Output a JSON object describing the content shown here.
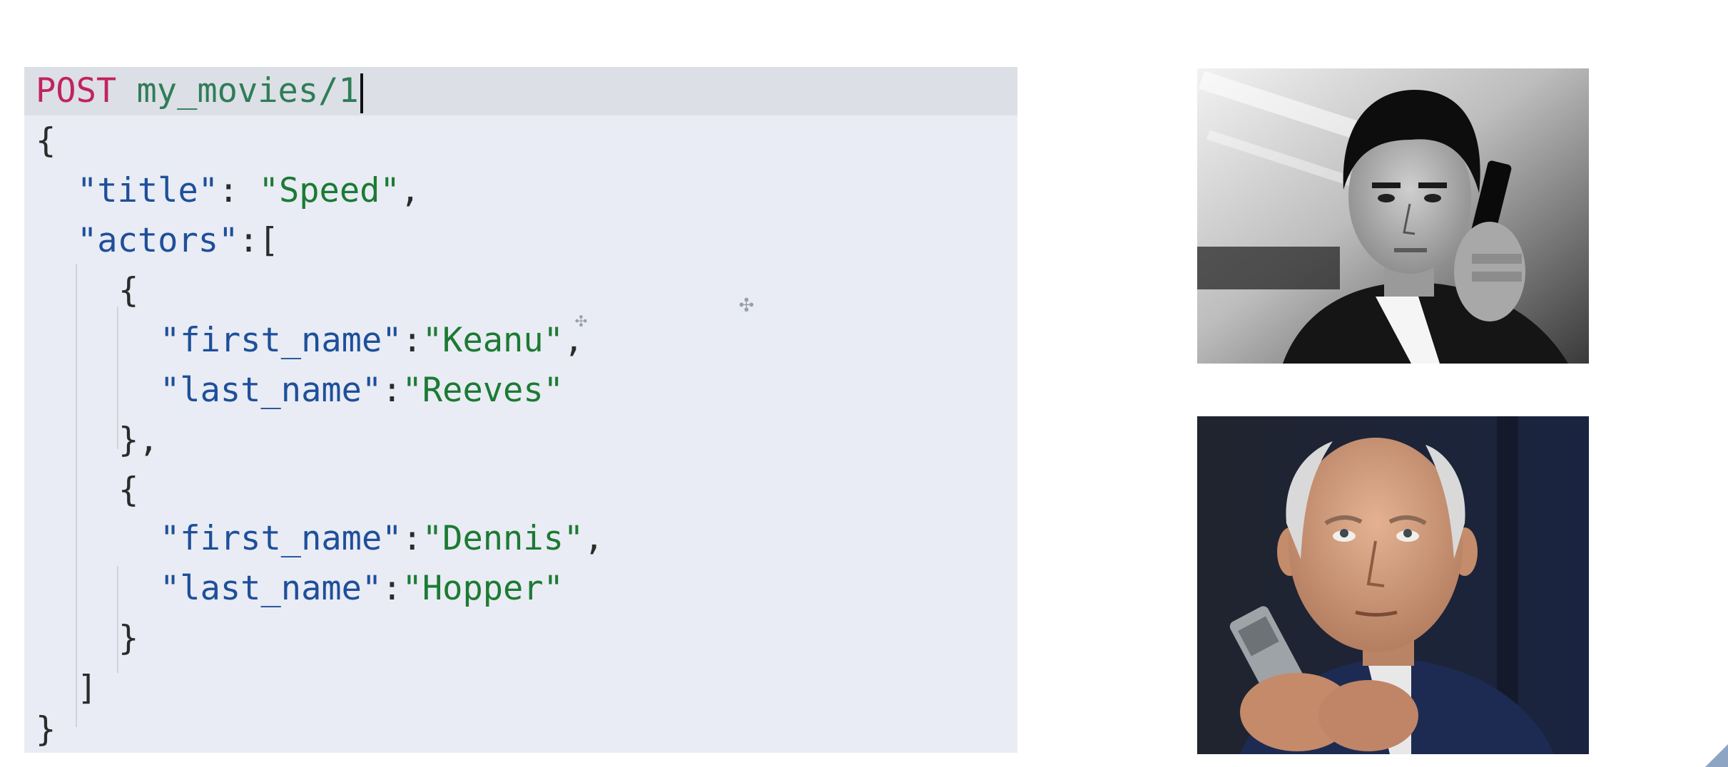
{
  "editor": {
    "request": {
      "method": "POST",
      "path": "my_movies/1"
    },
    "body": {
      "open_brace": "{",
      "title_key": "\"title\"",
      "title_sep": ": ",
      "title_value": "\"Speed\"",
      "title_comma": ",",
      "actors_key": "\"actors\"",
      "actors_open": ":[",
      "actor1_open": "{",
      "actor1_first_key": "\"first_name\"",
      "actor1_first_value": "\"Keanu\"",
      "actor1_first_comma": ",",
      "actor1_last_key": "\"last_name\"",
      "actor1_last_value": "\"Reeves\"",
      "actor1_close": "},",
      "actor2_open": "{",
      "actor2_first_key": "\"first_name\"",
      "actor2_first_value": "\"Dennis\"",
      "actor2_first_comma": ",",
      "actor2_last_key": "\"last_name\"",
      "actor2_last_value": "\"Hopper\"",
      "actor2_close": "}",
      "actors_close": "]",
      "close_brace": "}",
      "colon": ":"
    }
  },
  "photos": [
    {
      "icon": "actor-photo-keanu-reeves",
      "style": "black-and-white"
    },
    {
      "icon": "actor-photo-dennis-hopper",
      "style": "color"
    }
  ],
  "colors": {
    "method": "#c0245c",
    "url": "#2f7d57",
    "key": "#1e4f9a",
    "string": "#1c7a33",
    "editor_bg": "#e9ecf4",
    "request_bg": "#dcdfe6"
  }
}
